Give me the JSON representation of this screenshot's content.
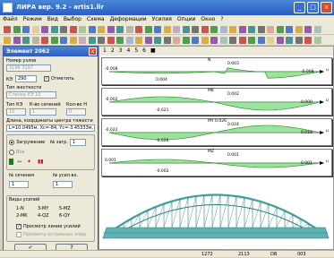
{
  "window": {
    "title": "ЛИРА  вер. 9.2  - artis1.lir"
  },
  "menu": [
    "Файл",
    "Режим",
    "Вид",
    "Выбор",
    "Схема",
    "Деформации",
    "Усилия",
    "Опции",
    "Окно",
    "?"
  ],
  "panel": {
    "title": "Элемент 2062",
    "name_label": "Номер узлов",
    "name_value": "3196 3197",
    "kv_label": "КЭ",
    "kv_value": "290",
    "show_label": "Отметить",
    "stiff_label": "Тип жесткости",
    "stiff_value": "Стенка КЭ 10",
    "row_a": "Тип КЭ",
    "row_b": "К-во сечений",
    "row_c": "Кол-во Н",
    "row_a_val": "10",
    "row_b_val": "1",
    "row_c_val": "0",
    "len_label": "Длина, координаты центра тяжести",
    "len_value": "L=10.0495м, Xc=-84, Yc=-3.45333м, Zc=55",
    "load_label": "Загружение",
    "load_num_label": "№ загр.",
    "load_num": "1",
    "all_label": "Все",
    "m_label": "№ сечения",
    "n_label": "№ усил.вх.",
    "m_value": "1",
    "n_value": "1",
    "forces_title": "Виды усилий",
    "forces": [
      "1-N",
      "3-MY",
      "5-MZ",
      "2-MK",
      "4-QZ",
      "6-QY"
    ],
    "check1": "Просмотр линии усилий",
    "check2": "Просмотр остальных эпюр",
    "ok_label": "✔",
    "help_label": "?"
  },
  "tabs": [
    "1",
    "2",
    "3",
    "4",
    "5",
    "6",
    "■"
  ],
  "plots": [
    {
      "name": "N",
      "left": "-0.008",
      "right": "-0.008",
      "top": "0.003",
      "bottom": "0.004",
      "u": "u"
    },
    {
      "name": "MK",
      "left": "-0.002",
      "right": "0.000",
      "top": "0.002",
      "bottom": "-0.021",
      "u": "u"
    },
    {
      "name": "MY 0.026",
      "left": "-0.022",
      "right": "0.018",
      "top": "0.024",
      "bottom": "-0.026",
      "u": "u"
    },
    {
      "name": "MZ",
      "left": "0.001",
      "right": "0.001",
      "top": "0.001",
      "bottom": "-0.002",
      "u": "u"
    }
  ],
  "status": {
    "cells": [
      "1272",
      "2113",
      "DB",
      "003"
    ]
  },
  "colors": {
    "accent": "#2a5cc0",
    "diagram": "#26a626",
    "model": "#3f9e9e"
  }
}
